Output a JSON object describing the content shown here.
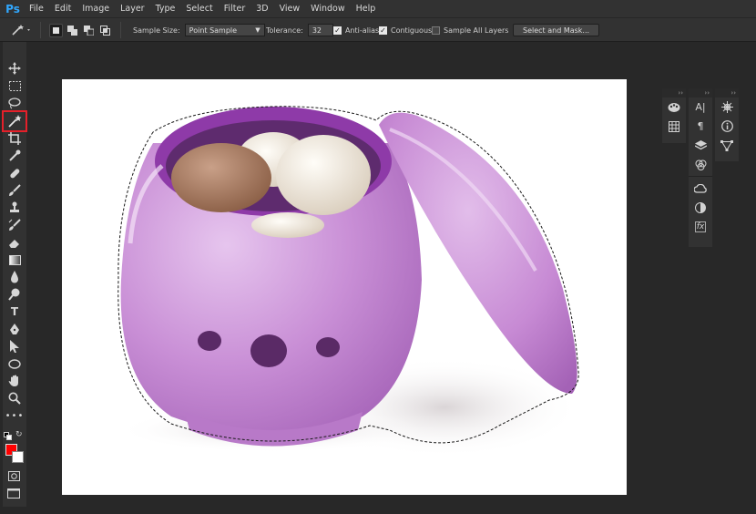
{
  "app": {
    "logo": "Ps"
  },
  "menu": [
    "File",
    "Edit",
    "Image",
    "Layer",
    "Type",
    "Select",
    "Filter",
    "3D",
    "View",
    "Window",
    "Help"
  ],
  "options": {
    "sample_size_label": "Sample Size:",
    "sample_size_value": "Point Sample",
    "tolerance_label": "Tolerance:",
    "tolerance_value": "32",
    "anti_alias_label": "Anti-alias",
    "anti_alias_checked": true,
    "contiguous_label": "Contiguous",
    "contiguous_checked": true,
    "sample_all_layers_label": "Sample All Layers",
    "sample_all_layers_checked": false,
    "select_mask_label": "Select and Mask..."
  },
  "tools": [
    {
      "name": "move-tool",
      "icon": "move-icon"
    },
    {
      "name": "marquee-tool",
      "icon": "rect-marquee-icon"
    },
    {
      "name": "lasso-tool",
      "icon": "lasso-icon"
    },
    {
      "name": "magic-wand-tool",
      "icon": "magic-wand-icon",
      "active": true
    },
    {
      "name": "crop-tool",
      "icon": "crop-icon"
    },
    {
      "name": "eyedropper-tool",
      "icon": "eyedropper-icon"
    },
    {
      "name": "healing-brush-tool",
      "icon": "bandage-icon"
    },
    {
      "name": "brush-tool",
      "icon": "brush-icon"
    },
    {
      "name": "clone-stamp-tool",
      "icon": "stamp-icon"
    },
    {
      "name": "history-brush-tool",
      "icon": "history-brush-icon"
    },
    {
      "name": "eraser-tool",
      "icon": "eraser-icon"
    },
    {
      "name": "gradient-tool",
      "icon": "gradient-icon"
    },
    {
      "name": "blur-tool",
      "icon": "drop-icon"
    },
    {
      "name": "dodge-tool",
      "icon": "dodge-icon"
    },
    {
      "name": "pen-tool",
      "icon": "pen-icon"
    },
    {
      "name": "type-tool",
      "icon": "type-icon"
    },
    {
      "name": "path-selection-tool",
      "icon": "arrow-icon"
    },
    {
      "name": "ellipse-tool",
      "icon": "ellipse-icon"
    },
    {
      "name": "hand-tool",
      "icon": "hand-icon"
    },
    {
      "name": "zoom-tool",
      "icon": "zoom-icon"
    },
    {
      "name": "more-tools",
      "icon": "ellipsis-icon"
    }
  ],
  "colors": {
    "foreground": "#ff0000",
    "background": "#ffffff",
    "highlight": "#e5202a",
    "pot": "#c98fd6",
    "pot_rim": "#8e3aa8"
  },
  "type_tool_label": "T",
  "dock_glyphs": {
    "character": "A|",
    "paragraph": "¶",
    "fx": "fx"
  }
}
